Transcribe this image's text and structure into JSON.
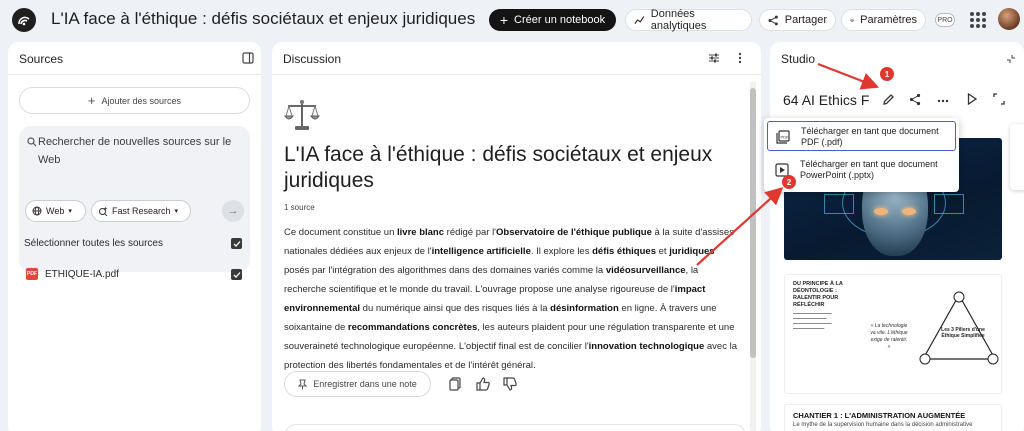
{
  "header": {
    "title": "L'IA face à l'éthique : défis sociétaux et enjeux juridiques",
    "create_notebook": "Créer un notebook",
    "analytics": "Données analytiques",
    "share": "Partager",
    "settings": "Paramètres",
    "pro_badge": "PRO"
  },
  "sources": {
    "title": "Sources",
    "add_button": "Ajouter des sources",
    "search_placeholder": "Rechercher de nouvelles sources sur le Web",
    "web_chip": "Web",
    "fast_research_chip": "Fast Research",
    "select_all": "Sélectionner toutes les sources",
    "files": [
      {
        "name": "ETHIQUE-IA.pdf",
        "badge": "PDF",
        "checked": true
      }
    ]
  },
  "chat": {
    "title": "Discussion",
    "notebook_title": "L'IA face à l'éthique : défis sociétaux et enjeux juridiques",
    "source_count": "1 source",
    "summary": [
      {
        "t": "Ce document constitue un "
      },
      {
        "t": "livre blanc",
        "b": true
      },
      {
        "t": " rédigé par l'"
      },
      {
        "t": "Observatoire de l'éthique publique",
        "b": true
      },
      {
        "t": " à la suite d'assises nationales dédiées aux enjeux de l'"
      },
      {
        "t": "intelligence artificielle",
        "b": true
      },
      {
        "t": ". Il explore les "
      },
      {
        "t": "défis éthiques",
        "b": true
      },
      {
        "t": " et "
      },
      {
        "t": "juridiques",
        "b": true
      },
      {
        "t": " posés par l'intégration des algorithmes dans des domaines variés comme la "
      },
      {
        "t": "vidéosurveillance",
        "b": true
      },
      {
        "t": ", la recherche scientifique et le monde du travail. L'ouvrage propose une analyse rigoureuse de l'"
      },
      {
        "t": "impact environnemental",
        "b": true
      },
      {
        "t": " du numérique ainsi que des risques liés à la "
      },
      {
        "t": "désinformation",
        "b": true
      },
      {
        "t": " en ligne. À travers une soixantaine de "
      },
      {
        "t": "recommandations concrètes",
        "b": true
      },
      {
        "t": ", les auteurs plaident pour une régulation transparente et une souveraineté technologique européenne. L'objectif final est de concilier l'"
      },
      {
        "t": "innovation technologique",
        "b": true
      },
      {
        "t": " avec la protection des libertés fondamentales et de l'intérêt général."
      }
    ],
    "save_note": "Enregistrer dans une note"
  },
  "studio": {
    "title": "Studio",
    "note_title": "64 AI Ethics F",
    "thumb2": {
      "heading": "DU PRINCIPE À LA DÉONTOLOGIE : RALENTIR POUR RÉFLÉCHIR",
      "quote": "« La technologie va vite. L'éthique exige de ralentir. »",
      "pillars": "Les 3 Piliers d'une Éthique Simplifiée"
    },
    "thumb3": {
      "heading": "CHANTIER 1 : L'ADMINISTRATION AUGMENTÉE",
      "sub": "Le mythe de la supervision humaine dans la décision administrative"
    },
    "menu": [
      "Télécharger en tant que document PDF (.pdf)",
      "Télécharger en tant que document PowerPoint (.pptx)"
    ]
  },
  "annotations": {
    "badge1": "1",
    "badge2": "2",
    "color": "#e0382f"
  }
}
